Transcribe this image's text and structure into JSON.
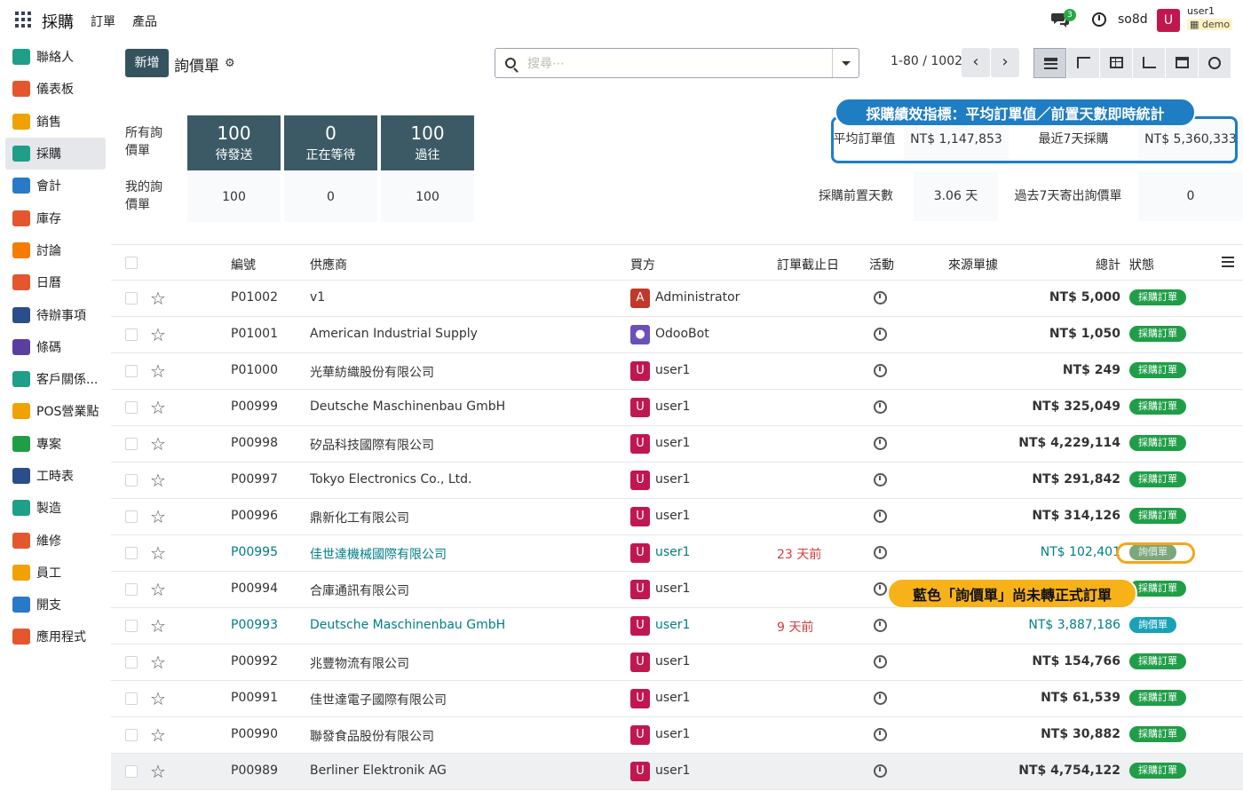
{
  "topbar": {
    "app_title": "採購",
    "menu": [
      "訂單",
      "產品"
    ],
    "chat_badge": "3",
    "db_name": "so8d",
    "user_initial": "U",
    "user_name": "user1",
    "db_tag": "demo"
  },
  "sidebar": {
    "items": [
      {
        "label": "聯絡人",
        "color": "#1f9e8a"
      },
      {
        "label": "儀表板",
        "color": "#e4572e"
      },
      {
        "label": "銷售",
        "color": "#f0a202"
      },
      {
        "label": "採購",
        "color": "#1f9e8a"
      },
      {
        "label": "會計",
        "color": "#2979c9"
      },
      {
        "label": "庫存",
        "color": "#e4572e"
      },
      {
        "label": "討論",
        "color": "#f57c00"
      },
      {
        "label": "日曆",
        "color": "#e4572e"
      },
      {
        "label": "待辦事項",
        "color": "#2a4e8a"
      },
      {
        "label": "條碼",
        "color": "#5b3fa0"
      },
      {
        "label": "客戶關係...",
        "color": "#1f9e8a"
      },
      {
        "label": "POS營業點",
        "color": "#f0a202"
      },
      {
        "label": "專案",
        "color": "#1f9e47"
      },
      {
        "label": "工時表",
        "color": "#2a4e8a"
      },
      {
        "label": "製造",
        "color": "#1f9e8a"
      },
      {
        "label": "維修",
        "color": "#e4572e"
      },
      {
        "label": "員工",
        "color": "#f0a202"
      },
      {
        "label": "開支",
        "color": "#2979c9"
      },
      {
        "label": "應用程式",
        "color": "#e4572e"
      }
    ]
  },
  "control": {
    "new_label": "新增",
    "title": "詢價單",
    "search_placeholder": "搜尋⋯",
    "pager": "1-80 / 1002"
  },
  "stats": {
    "all_label": "所有詢價單",
    "my_label": "我的詢價單",
    "tiles": [
      {
        "value": "100",
        "label": "待發送",
        "mine": "100"
      },
      {
        "value": "0",
        "label": "正在等待",
        "mine": "0"
      },
      {
        "value": "100",
        "label": "過往",
        "mine": "100"
      }
    ],
    "kpi": {
      "avg_order_label": "平均訂單值",
      "avg_order_value": "NT$ 1,147,853",
      "last7_label": "最近7天採購",
      "last7_value": "NT$ 5,360,333",
      "lead_label": "採購前置天數",
      "lead_value": "3.06 天",
      "sent_label": "過去7天寄出詢價單",
      "sent_value": "0"
    }
  },
  "callouts": {
    "kpi_note": "採購績效指標：平均訂單值／前置天數即時統計",
    "rfq_note": "藍色「詢價單」尚未轉正式訂單"
  },
  "table": {
    "headers": {
      "ref": "編號",
      "vendor": "供應商",
      "buyer": "買方",
      "deadline": "訂單截止日",
      "activity": "活動",
      "source": "來源單據",
      "total": "總計",
      "status": "狀態"
    },
    "rows": [
      {
        "ref": "P01002",
        "vendor": "v1",
        "buyer_initial": "A",
        "buyer_color": "#c0392b",
        "buyer": "Administrator",
        "deadline": "",
        "total": "NT$ 5,000",
        "status": "採購訂單"
      },
      {
        "ref": "P01001",
        "vendor": "American Industrial Supply",
        "buyer_initial": "●",
        "buyer_color": "#6b4fbb",
        "buyer": "OdooBot",
        "deadline": "",
        "total": "NT$ 1,050",
        "status": "採購訂單"
      },
      {
        "ref": "P01000",
        "vendor": "光華紡織股份有限公司",
        "buyer_initial": "U",
        "buyer_color": "#c0174f",
        "buyer": "user1",
        "deadline": "",
        "total": "NT$ 249",
        "status": "採購訂單"
      },
      {
        "ref": "P00999",
        "vendor": "Deutsche Maschinenbau GmbH",
        "buyer_initial": "U",
        "buyer_color": "#c0174f",
        "buyer": "user1",
        "deadline": "",
        "total": "NT$ 325,049",
        "status": "採購訂單"
      },
      {
        "ref": "P00998",
        "vendor": "矽品科技國際有限公司",
        "buyer_initial": "U",
        "buyer_color": "#c0174f",
        "buyer": "user1",
        "deadline": "",
        "total": "NT$ 4,229,114",
        "status": "採購訂單"
      },
      {
        "ref": "P00997",
        "vendor": "Tokyo Electronics Co., Ltd.",
        "buyer_initial": "U",
        "buyer_color": "#c0174f",
        "buyer": "user1",
        "deadline": "",
        "total": "NT$ 291,842",
        "status": "採購訂單"
      },
      {
        "ref": "P00996",
        "vendor": "鼎新化工有限公司",
        "buyer_initial": "U",
        "buyer_color": "#c0174f",
        "buyer": "user1",
        "deadline": "",
        "total": "NT$ 314,126",
        "status": "採購訂單"
      },
      {
        "ref": "P00995",
        "vendor": "佳世達機械國際有限公司",
        "buyer_initial": "U",
        "buyer_color": "#c0174f",
        "buyer": "user1",
        "deadline": "23 天前",
        "total": "NT$ 102,401",
        "status": "詢價單"
      },
      {
        "ref": "P00994",
        "vendor": "合庫通訊有限公司",
        "buyer_initial": "U",
        "buyer_color": "#c0174f",
        "buyer": "user1",
        "deadline": "",
        "total": "",
        "status": "採購訂單"
      },
      {
        "ref": "P00993",
        "vendor": "Deutsche Maschinenbau GmbH",
        "buyer_initial": "U",
        "buyer_color": "#c0174f",
        "buyer": "user1",
        "deadline": "9 天前",
        "total": "NT$ 3,887,186",
        "status": "詢價單"
      },
      {
        "ref": "P00992",
        "vendor": "兆豐物流有限公司",
        "buyer_initial": "U",
        "buyer_color": "#c0174f",
        "buyer": "user1",
        "deadline": "",
        "total": "NT$ 154,766",
        "status": "採購訂單"
      },
      {
        "ref": "P00991",
        "vendor": "佳世達電子國際有限公司",
        "buyer_initial": "U",
        "buyer_color": "#c0174f",
        "buyer": "user1",
        "deadline": "",
        "total": "NT$ 61,539",
        "status": "採購訂單"
      },
      {
        "ref": "P00990",
        "vendor": "聯發食品股份有限公司",
        "buyer_initial": "U",
        "buyer_color": "#c0174f",
        "buyer": "user1",
        "deadline": "",
        "total": "NT$ 30,882",
        "status": "採購訂單"
      },
      {
        "ref": "P00989",
        "vendor": "Berliner Elektronik AG",
        "buyer_initial": "U",
        "buyer_color": "#c0174f",
        "buyer": "user1",
        "deadline": "",
        "total": "NT$ 4,754,122",
        "status": "採購訂單"
      }
    ]
  }
}
